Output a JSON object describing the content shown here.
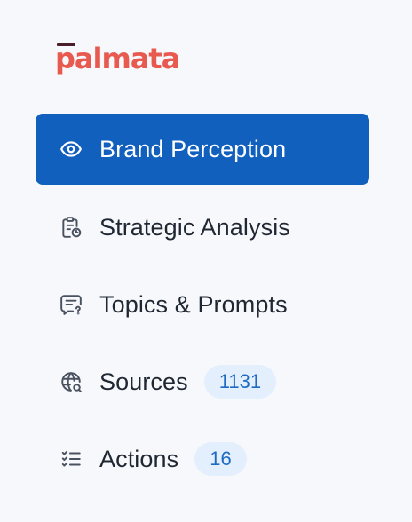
{
  "brand": {
    "logo_text": "palmata",
    "accent_color": "#e85a4f",
    "bar_color": "#4a1f2c"
  },
  "nav": {
    "active_color": "#1160be",
    "items": [
      {
        "label": "Brand Perception",
        "icon": "eye-icon",
        "active": true
      },
      {
        "label": "Strategic Analysis",
        "icon": "clipboard-clock-icon",
        "active": false
      },
      {
        "label": "Topics & Prompts",
        "icon": "message-question-icon",
        "active": false
      },
      {
        "label": "Sources",
        "icon": "globe-search-icon",
        "active": false,
        "badge": "1131"
      },
      {
        "label": "Actions",
        "icon": "checklist-icon",
        "active": false,
        "badge": "16"
      }
    ]
  }
}
